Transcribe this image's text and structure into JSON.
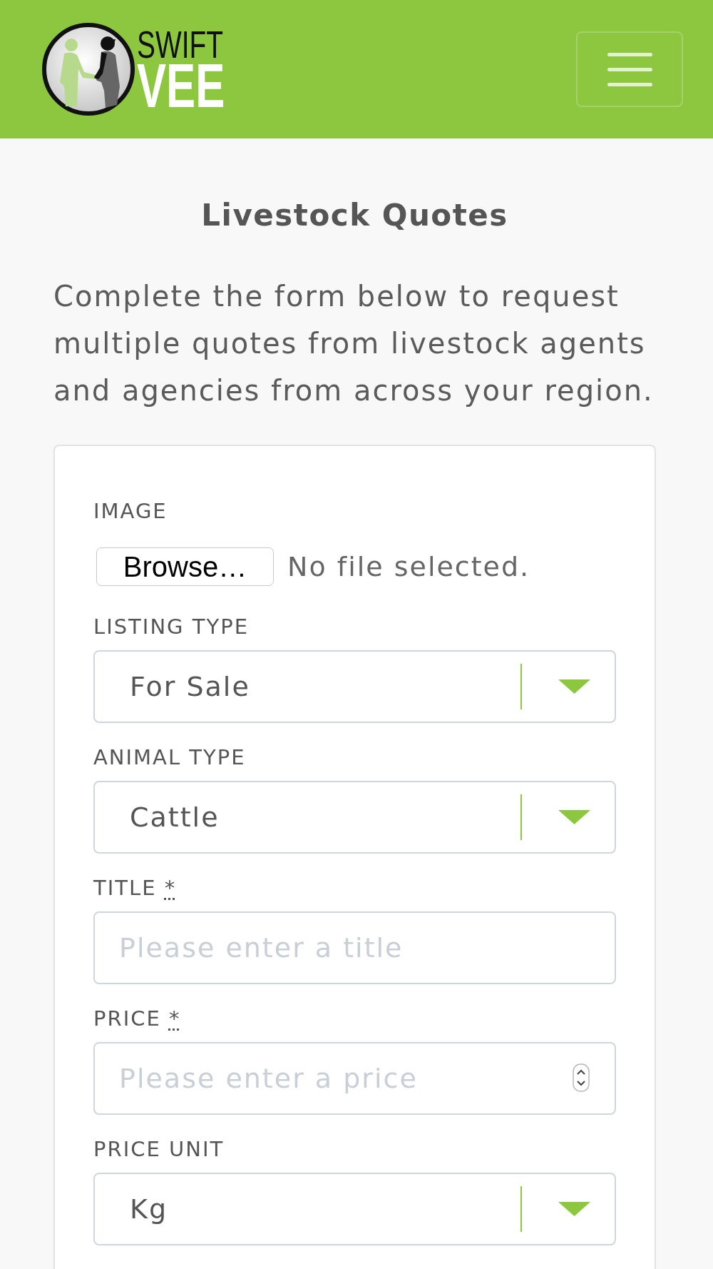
{
  "header": {
    "logo": {
      "line_1": "SWIFT",
      "line_2": "VEE"
    }
  },
  "page": {
    "title": "Livestock Quotes",
    "intro": "Complete the form below to request multiple quotes from livestock agents and agencies from across your region."
  },
  "form": {
    "fields": [
      {
        "kind": "file",
        "label": "IMAGE",
        "button": "Browse…",
        "status": "No file selected."
      },
      {
        "kind": "select",
        "label": "LISTING TYPE",
        "value": "For Sale"
      },
      {
        "kind": "select",
        "label": "ANIMAL TYPE",
        "value": "Cattle"
      },
      {
        "kind": "text",
        "label": "TITLE",
        "required_mark": "*",
        "placeholder": "Please enter a title"
      },
      {
        "kind": "number",
        "label": "PRICE",
        "required_mark": "*",
        "placeholder": "Please enter a price"
      },
      {
        "kind": "select",
        "label": "PRICE UNIT",
        "value": "Kg"
      }
    ]
  }
}
